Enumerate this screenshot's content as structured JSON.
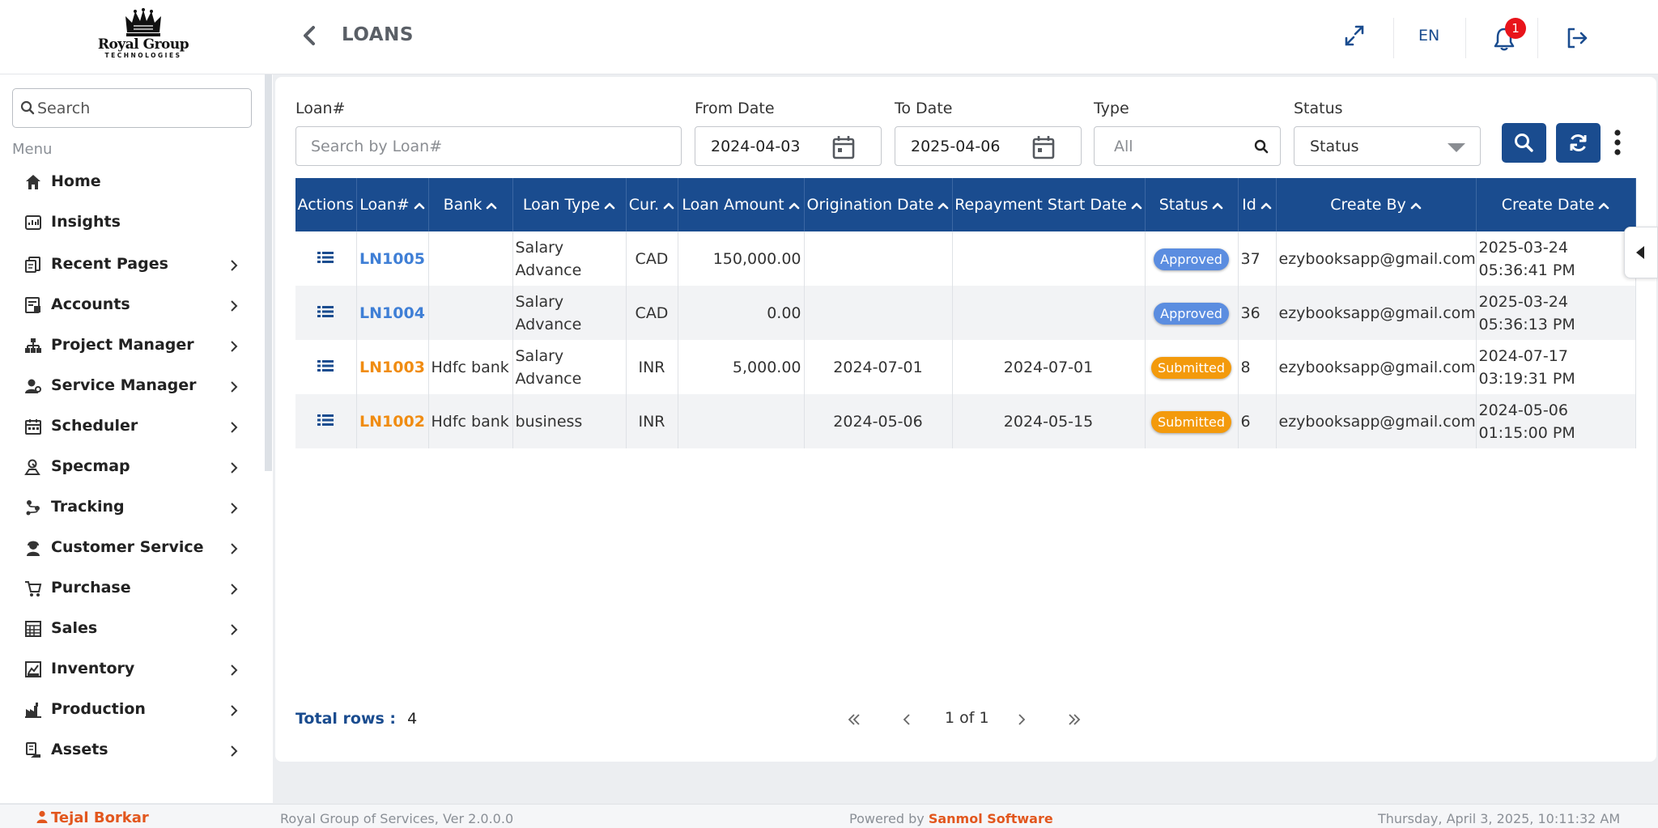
{
  "brand": {
    "name": "Royal Group",
    "sub": "TECHNOLOGIES"
  },
  "header": {
    "title": "LOANS",
    "language": "EN",
    "notifications_count": "1"
  },
  "sidebar": {
    "search_placeholder": "Search",
    "menu_title": "Menu",
    "items": [
      {
        "label": "Home",
        "icon": "home-icon",
        "chevron": false
      },
      {
        "label": "Insights",
        "icon": "insights-icon",
        "chevron": false
      },
      {
        "label": "Recent Pages",
        "icon": "recent-pages-icon",
        "chevron": true
      },
      {
        "label": "Accounts",
        "icon": "accounts-icon",
        "chevron": true
      },
      {
        "label": "Project Manager",
        "icon": "project-manager-icon",
        "chevron": true
      },
      {
        "label": "Service Manager",
        "icon": "service-manager-icon",
        "chevron": true
      },
      {
        "label": "Scheduler",
        "icon": "scheduler-icon",
        "chevron": true
      },
      {
        "label": "Specmap",
        "icon": "specmap-icon",
        "chevron": true
      },
      {
        "label": "Tracking",
        "icon": "tracking-icon",
        "chevron": true
      },
      {
        "label": "Customer Service",
        "icon": "customer-service-icon",
        "chevron": true
      },
      {
        "label": "Purchase",
        "icon": "purchase-icon",
        "chevron": true
      },
      {
        "label": "Sales",
        "icon": "sales-icon",
        "chevron": true
      },
      {
        "label": "Inventory",
        "icon": "inventory-icon",
        "chevron": true
      },
      {
        "label": "Production",
        "icon": "production-icon",
        "chevron": true
      },
      {
        "label": "Assets",
        "icon": "assets-icon",
        "chevron": true
      }
    ]
  },
  "filters": {
    "loan_label": "Loan#",
    "loan_placeholder": "Search by Loan#",
    "from_label": "From Date",
    "from_value": "2024-04-03",
    "to_label": "To Date",
    "to_value": "2025-04-06",
    "type_label": "Type",
    "type_placeholder": "All",
    "status_label": "Status",
    "status_value": "Status"
  },
  "table": {
    "columns": [
      "Actions",
      "Loan#",
      "Bank",
      "Loan Type",
      "Cur.",
      "Loan Amount",
      "Origination Date",
      "Repayment Start Date",
      "Status",
      "Id",
      "Create By",
      "Create Date"
    ],
    "rows": [
      {
        "loan": "LN1005",
        "bank": "",
        "type_1": "Salary",
        "type_2": "Advance",
        "cur": "CAD",
        "amount": "150,000.00",
        "orig": "",
        "repay": "",
        "status": "Approved",
        "id": "37",
        "by": "ezybooksapp@gmail.com",
        "date_1": "2025-03-24",
        "date_2": "05:36:41 PM"
      },
      {
        "loan": "LN1004",
        "bank": "",
        "type_1": "Salary",
        "type_2": "Advance",
        "cur": "CAD",
        "amount": "0.00",
        "orig": "",
        "repay": "",
        "status": "Approved",
        "id": "36",
        "by": "ezybooksapp@gmail.com",
        "date_1": "2025-03-24",
        "date_2": "05:36:13 PM"
      },
      {
        "loan": "LN1003",
        "bank": "Hdfc bank",
        "type_1": "Salary",
        "type_2": "Advance",
        "cur": "INR",
        "amount": "5,000.00",
        "orig": "2024-07-01",
        "repay": "2024-07-01",
        "status": "Submitted",
        "id": "8",
        "by": "ezybooksapp@gmail.com",
        "date_1": "2024-07-17",
        "date_2": "03:19:31 PM"
      },
      {
        "loan": "LN1002",
        "bank": "Hdfc bank",
        "type_1": "business",
        "type_2": "",
        "cur": "INR",
        "amount": "",
        "orig": "2024-05-06",
        "repay": "2024-05-15",
        "status": "Submitted",
        "id": "6",
        "by": "ezybooksapp@gmail.com",
        "date_1": "2024-05-06",
        "date_2": "01:15:00 PM"
      }
    ]
  },
  "pagination": {
    "total_label": "Total rows :",
    "total_value": "4",
    "page_text": "1 of 1"
  },
  "footer": {
    "user": "Tejal Borkar",
    "version": "Royal Group of Services, Ver 2.0.0.0",
    "powered_prefix": "Powered by",
    "powered_brand": "Sanmol Software",
    "datetime": "Thursday, April 3, 2025, 10:11:32 AM"
  },
  "colors": {
    "primary": "#1a4c8f",
    "approved": "#5b8de0",
    "submitted": "#f39a0c",
    "link_blue": "#3f7fd6",
    "link_orange": "#f08c12",
    "accent": "#e2571e",
    "badge_red": "#e8141b"
  }
}
